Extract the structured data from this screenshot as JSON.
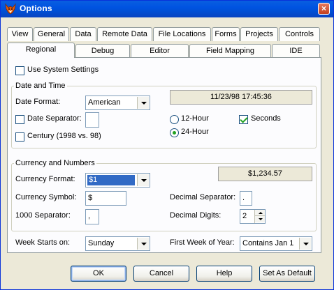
{
  "window": {
    "title": "Options",
    "close_glyph": "×"
  },
  "tabs_row1": [
    "View",
    "General",
    "Data",
    "Remote Data",
    "File Locations",
    "Forms",
    "Projects",
    "Controls"
  ],
  "tabs_row2": [
    "Regional",
    "Debug",
    "Editor",
    "Field Mapping",
    "IDE"
  ],
  "selected_tab": "Regional",
  "use_system_settings": {
    "label": "Use System Settings",
    "checked": false
  },
  "date_time": {
    "group_title": "Date and Time",
    "date_format_label": "Date Format:",
    "date_format_value": "American",
    "preview": "11/23/98 17:45:36",
    "date_separator_label": "Date Separator:",
    "date_separator_checked": false,
    "date_separator_value": "",
    "century_label": "Century (1998 vs. 98)",
    "century_checked": false,
    "hour12_label": "12-Hour",
    "hour24_label": "24-Hour",
    "hour_mode": "24",
    "seconds_label": "Seconds",
    "seconds_checked": true
  },
  "currency": {
    "group_title": "Currency and Numbers",
    "currency_format_label": "Currency Format:",
    "currency_format_value": "$1",
    "preview": "$1,234.57",
    "currency_symbol_label": "Currency Symbol:",
    "currency_symbol_value": "$",
    "thousand_sep_label": "1000 Separator:",
    "thousand_sep_value": ",",
    "decimal_sep_label": "Decimal Separator:",
    "decimal_sep_value": ".",
    "decimal_digits_label": "Decimal Digits:",
    "decimal_digits_value": "2"
  },
  "week": {
    "starts_on_label": "Week Starts on:",
    "starts_on_value": "Sunday",
    "first_week_label": "First Week of Year:",
    "first_week_value": "Contains Jan 1"
  },
  "buttons": {
    "ok": "OK",
    "cancel": "Cancel",
    "help": "Help",
    "set_default": "Set As Default"
  },
  "colors": {
    "titlebar": "#0054e3",
    "dialog_bg": "#ece9d8",
    "selection": "#316ac5"
  },
  "icons": {
    "app": "fox-icon",
    "close": "close-icon"
  }
}
